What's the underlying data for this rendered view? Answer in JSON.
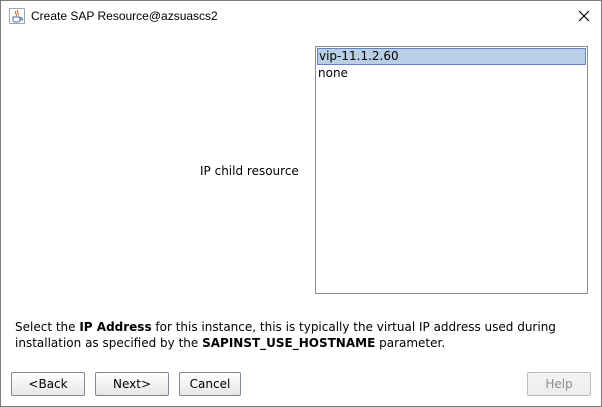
{
  "window": {
    "title": "Create SAP Resource@azsuascs2",
    "app_icon": "java-cup-icon",
    "close_icon": "close-icon"
  },
  "ip_child_resource": {
    "label": "IP child resource",
    "options": [
      "vip-11.1.2.60",
      "none"
    ],
    "selected": "vip-11.1.2.60"
  },
  "description": {
    "prefix": "Select the ",
    "bold1": "IP Address",
    "middle": " for this instance, this is typically the virtual IP address used during installation as specified by the ",
    "bold2": "SAPINST_USE_HOSTNAME",
    "suffix": " parameter."
  },
  "buttons": {
    "back": "<Back",
    "next": "Next>",
    "cancel": "Cancel",
    "help": "Help",
    "help_enabled": false
  },
  "colors": {
    "selection_bg": "#b8cfe5",
    "selection_border": "#6382bf",
    "disabled_text": "#8c8c8c"
  }
}
